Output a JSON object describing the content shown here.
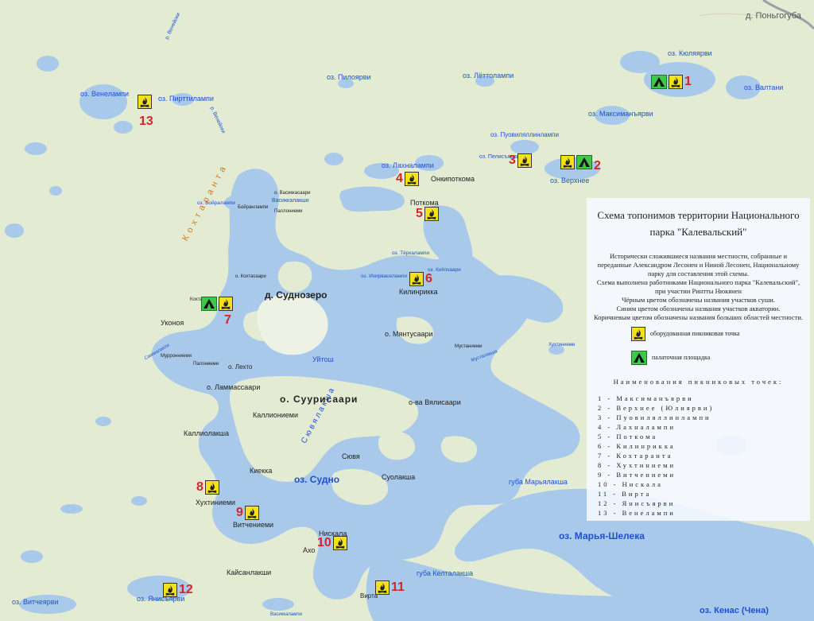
{
  "colors": {
    "land": "#e3ecd3",
    "water": "#a8c9ea",
    "water_label": "#1e4fd0",
    "marker_number": "#d2262a",
    "picnic": "#f3e21a",
    "tent": "#3cc94a"
  },
  "settlements": {
    "pongoguba": "д. Поньгогуба",
    "sudnozero": "д. Суднозеро"
  },
  "islands": {
    "suurisaari": "о. Суурисаари",
    "myantusaari": "о. Мянтусаари",
    "lekto": "о. Лехто",
    "lammassaari": "о. Ламмассаари",
    "vyalisaari": "о-ва Вялисаари"
  },
  "lakes": {
    "kyulyarvi": "оз. Кюляярви",
    "valtani": "оз. Валтани",
    "maksimanyarvi": "оз. Максиманъярви",
    "lettolampi": "оз. Лёттолампи",
    "pilоyarvi": "оз. Пилоярви",
    "venelampi": "оз. Венелампи",
    "pirttilampi": "оз. Пирттилампи",
    "puovilyalampi": "оз. Пуовиляллинлампи",
    "pelisyarvi": "оз. Пелисъярви",
    "verhnee": "оз. Верхнее",
    "lahnalampi": "оз. Лахналампи",
    "sudno": "оз. Судно",
    "marya_sheleka": "оз. Марья-Шелека",
    "kenas": "оз. Кенас (Чена)",
    "yanisyarvi": "оз. Янисъярви",
    "vitcheyarvi": "оз. Витчеярви",
    "boiralampi": "оз. Бойралампи",
    "kilinsaari": "оз. Киlinsаари",
    "terkkalampi": "оз. Тёркалампи",
    "ihirvaselampi": "оз. Ихирваселампи"
  },
  "rivers": {
    "venekoski": "р. Венейоки",
    "venekoski2": "р. Венейоки"
  },
  "bays": {
    "maryalaksha": "губа Марьялакша",
    "keltalaksha": "губа Келталакша"
  },
  "areas": {
    "kokhtaranta": "К о х т а р а н т а",
    "syuvyalaksha": "С ю в я л а к ш а"
  },
  "places": {
    "onkipotkoma": "Онкипоткома",
    "potkoma": "Поткома",
    "kilinrikka": "Килинрикка",
    "ukonoya": "Уконоя",
    "uitosh": "Уйтош",
    "kallioniemi": "Каллиониеми",
    "kalliolaksha": "Каллиолакша",
    "kiekka": "Киекка",
    "suolaksha": "Суолакша",
    "syuvya": "Сювя",
    "huhtiniemi": "Хухтиниеми",
    "vitcheniemi": "Витчениеми",
    "niskala": "Нискала",
    "aho": "Ахо",
    "kaisanlakshi": "Кайсанлакши",
    "virta": "Вирта",
    "vasikkalakshi": "Васиккалакши",
    "vasikkasaari": "о. Васиккасаари",
    "pallonniemi": "Паллониеми",
    "boiranlampi_place": "Бойранлампи",
    "kokhtasaari": "о. Кохтасаари",
    "kokhtaniemi": "Кохтаниеми",
    "murronniemi": "Мурронниеми",
    "palonniemi": "Палониеми",
    "mustaniemi": "Мустаниеми",
    "mustalaksha": "Мусталакша",
    "hukhtiniemi2": "Хухтиниеми",
    "sammalahti": "Саммалахти",
    "vasikkalampi": "Васиккалампи"
  },
  "markers": [
    {
      "num": "1",
      "tent": true,
      "picnic": true
    },
    {
      "num": "2",
      "tent": true,
      "picnic": true
    },
    {
      "num": "3",
      "tent": false,
      "picnic": true
    },
    {
      "num": "4",
      "tent": false,
      "picnic": true
    },
    {
      "num": "5",
      "tent": false,
      "picnic": true
    },
    {
      "num": "6",
      "tent": false,
      "picnic": true
    },
    {
      "num": "7",
      "tent": true,
      "picnic": true
    },
    {
      "num": "8",
      "tent": false,
      "picnic": true
    },
    {
      "num": "9",
      "tent": false,
      "picnic": true
    },
    {
      "num": "10",
      "tent": false,
      "picnic": true
    },
    {
      "num": "11",
      "tent": false,
      "picnic": true
    },
    {
      "num": "12",
      "tent": false,
      "picnic": true
    },
    {
      "num": "13",
      "tent": false,
      "picnic": true
    }
  ],
  "legend": {
    "title": "Схема топонимов территории Национального парка \"Калевальский\"",
    "desc_1": "Исторически сложившиеся названия местности, собранные и переданные Александром Лесонен и Ниной Лесонен, Национальному парку для составления этой схемы.",
    "desc_2": "Схема выполнена работниками Национального парка \"Калевальский\", при участии Ринтты Нюкянен",
    "desc_3": "Чёрным цветом обозначены названия участков суши.",
    "desc_4": "Синим цветом обозначены названия участков акватории.",
    "desc_5": "Коричневым цветом обозначены названия больших областей местности.",
    "picnic_label": "оборудованная пикниковая точка",
    "tent_label": "палаточная площадка",
    "list_title": "Наименования пикниковых точек:",
    "list": [
      "1 -  Максиманъярви",
      "2 -  Верхнее (Юлиярви)",
      "3 -  Пуовиляллинлампи",
      "4 -  Лахналампи",
      "5 -  Поткома",
      "6 -  Килинрикка",
      "7 -  Кохтаранта",
      "8 -  Хухтиниеми",
      "9 -  Витчениеми",
      "10 -  Нискала",
      "11 -  Вирта",
      "12 -  Янисъярви",
      "13 -  Венелампи"
    ]
  }
}
